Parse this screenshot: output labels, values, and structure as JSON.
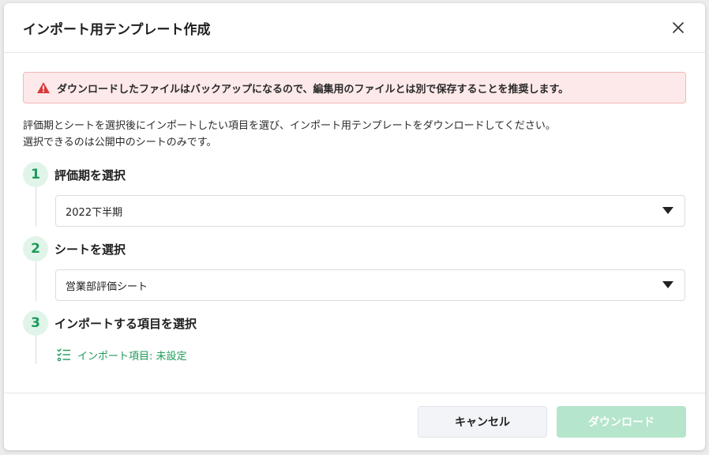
{
  "dialog": {
    "title": "インポート用テンプレート作成",
    "close_icon": "close-icon"
  },
  "alert": {
    "icon": "warning-icon",
    "text": "ダウンロードしたファイルはバックアップになるので、編集用のファイルとは別で保存することを推奨します。",
    "icon_color": "#d93a3a"
  },
  "description": {
    "line1": "評価期とシートを選択後にインポートしたい項目を選び、インポート用テンプレートをダウンロードしてください。",
    "line2": "選択できるのは公開中のシートのみです。"
  },
  "steps": [
    {
      "number": "1",
      "title": "評価期を選択",
      "selected_value": "2022下半期"
    },
    {
      "number": "2",
      "title": "シートを選択",
      "selected_value": "営業部評価シート"
    },
    {
      "number": "3",
      "title": "インポートする項目を選択",
      "link_text": "インポート項目: 未設定",
      "link_icon": "checklist-icon"
    }
  ],
  "footer": {
    "cancel_label": "キャンセル",
    "download_label": "ダウンロード"
  },
  "colors": {
    "accent": "#1e9a5a",
    "step_bg": "#e1f4ea",
    "download_disabled": "#b5e5cb",
    "alert_bg": "#fde9ea",
    "alert_border": "#f2b8b8"
  }
}
